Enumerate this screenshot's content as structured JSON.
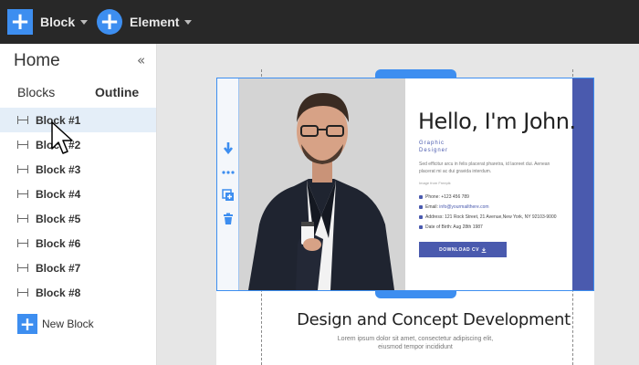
{
  "topbar": {
    "block_label": "Block",
    "element_label": "Element",
    "plus_glyph": "+"
  },
  "sidebar": {
    "title": "Home",
    "collapse_glyph": "«",
    "tabs": [
      {
        "label": "Blocks",
        "active": false
      },
      {
        "label": "Outline",
        "active": true
      }
    ],
    "items": [
      {
        "label": "Block #1",
        "active": true
      },
      {
        "label": "Block #2",
        "active": false
      },
      {
        "label": "Block #3",
        "active": false
      },
      {
        "label": "Block #4",
        "active": false
      },
      {
        "label": "Block #5",
        "active": false
      },
      {
        "label": "Block #6",
        "active": false
      },
      {
        "label": "Block #7",
        "active": false
      },
      {
        "label": "Block #8",
        "active": false
      }
    ],
    "new_block_label": "New Block"
  },
  "block_tools": [
    "arrow-down-icon",
    "more-horizontal-icon",
    "duplicate-icon",
    "trash-icon"
  ],
  "hero": {
    "name": "Hello, I'm John.",
    "role_line1": "Graphic",
    "role_line2": "Designer",
    "text": "Sed efficitur arcu in felis placerat pharetra, id laoreet dui. Aenean placerat mi ac dui gravida interdum.",
    "signature": "Image from Freepik",
    "phone": "Phone: +123 456 789",
    "email_prefix": "Email:",
    "email": "info@yourmailthere.com",
    "address": "Address: 121 Rock Street, 21 Avenue,New York, NY 92103-9000",
    "dob": "Date of Birth: Aug 28th 1987",
    "button": "DOWNLOAD CV"
  },
  "section": {
    "title": "Design and Concept Development",
    "text_line1": "Lorem ipsum dolor sit amet, consectetur adipiscing elit,",
    "text_line2": "eiusmod tempor incididunt"
  },
  "colors": {
    "accent": "#3d8ef0",
    "hero_accent": "#4a5aae",
    "topbar_bg": "#282828"
  }
}
